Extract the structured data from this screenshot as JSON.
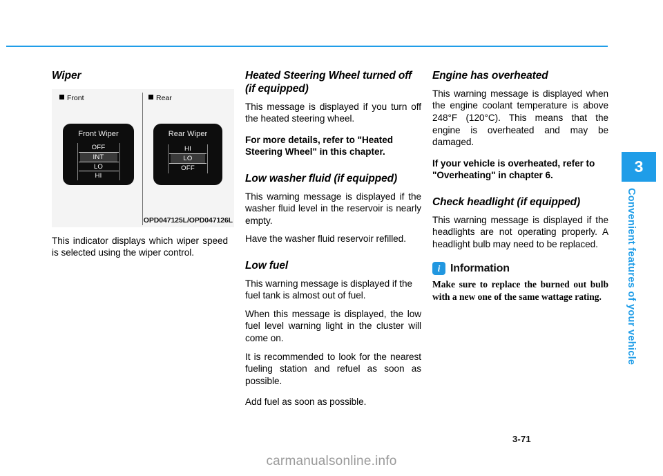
{
  "document": {
    "page_number": "3-71",
    "watermark": "carmanualsonline.info",
    "chapter_number": "3",
    "chapter_title": "Convenient features of your vehicle"
  },
  "left_column": {
    "heading": "Wiper",
    "figure": {
      "label_front": "Front",
      "label_rear": "Rear",
      "front_cluster": {
        "title": "Front Wiper",
        "options": [
          "OFF",
          "INT",
          "LO",
          "HI"
        ],
        "selected": "INT"
      },
      "rear_cluster": {
        "title": "Rear Wiper",
        "options": [
          "HI",
          "LO",
          "OFF"
        ],
        "selected": "LO"
      },
      "caption": "OPD047125L/OPD047126L"
    },
    "paragraph": "This indicator displays which wiper speed is selected using the wiper control."
  },
  "middle_column": {
    "heated_steering": {
      "heading": "Heated Steering Wheel turned off (if equipped)",
      "paragraph": "This message is displayed if you turn off the heated steering wheel.",
      "bold_note": "For more details, refer to \"Heated Steering Wheel\" in this chapter."
    },
    "low_washer": {
      "heading": "Low washer fluid (if equipped)",
      "paragraph_1": "This warning message is displayed if the washer fluid level in the reservoir is nearly empty.",
      "paragraph_2": "Have the washer fluid reservoir refilled."
    },
    "low_fuel": {
      "heading": "Low fuel",
      "paragraph_1": "This warning message is displayed if the fuel tank is almost out of fuel.",
      "paragraph_2": "When this message is displayed, the low fuel level warning light in the cluster will come on.",
      "paragraph_3": "It is recommended to look for the nearest fueling station and refuel as soon as possible.",
      "paragraph_4": "Add fuel as soon as possible."
    }
  },
  "right_column": {
    "engine_overheated": {
      "heading": "Engine has overheated",
      "paragraph": "This warning message is displayed when the engine coolant temperature is above 248°F (120°C). This means that the engine is overheated and may be damaged.",
      "bold_note": "If your vehicle is overheated, refer to \"Overheating\" in chapter 6."
    },
    "check_headlight": {
      "heading": "Check headlight (if equipped)",
      "paragraph": "This warning message is displayed if the headlights are not operating properly. A headlight bulb may need to be replaced."
    },
    "information": {
      "title": "Information",
      "icon": "info-icon",
      "body": "Make sure to replace the burned out bulb with a new one of the same wattage rating."
    }
  },
  "colors": {
    "accent_blue": "#1f9de8",
    "info_blue": "#2197e0",
    "figure_bg": "#f4f4f4",
    "cluster_bg": "#0d0d0d"
  }
}
